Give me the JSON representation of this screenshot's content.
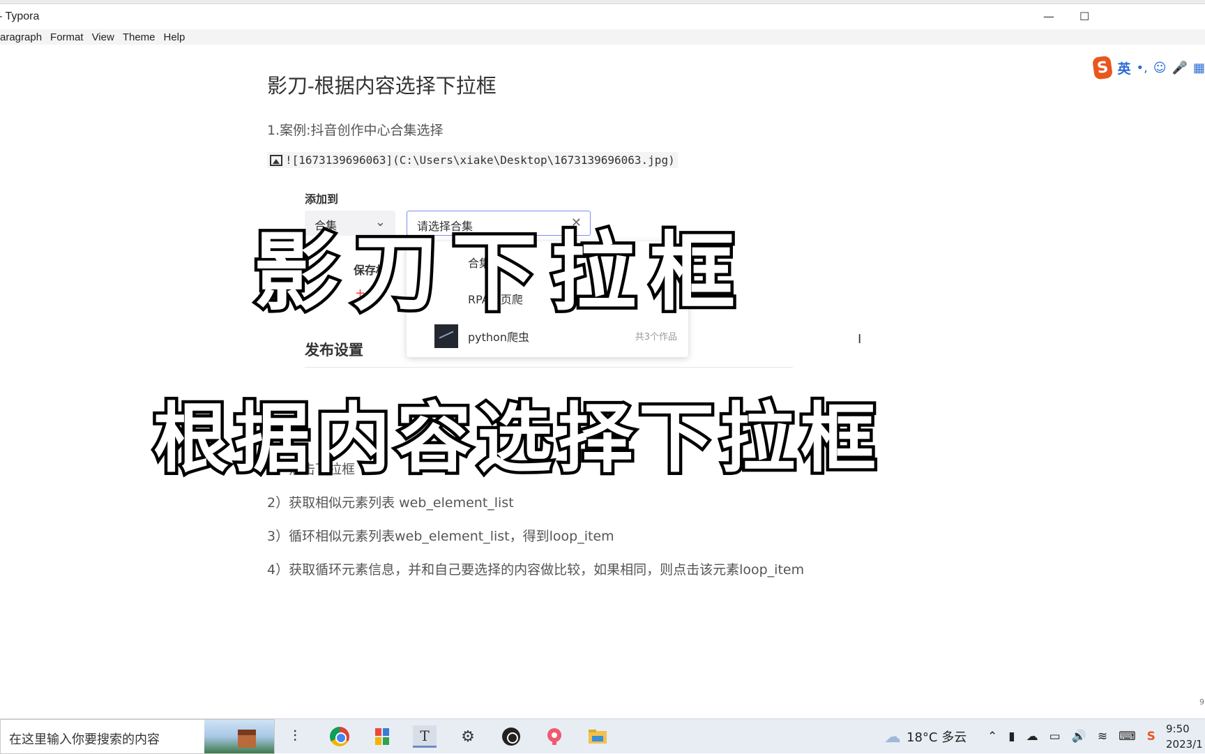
{
  "window": {
    "title": "- Typora",
    "minimize": "—",
    "maximize": "☐"
  },
  "menubar": {
    "items": [
      "aragraph",
      "Format",
      "View",
      "Theme",
      "Help"
    ]
  },
  "ime": {
    "logo": "S",
    "mode": "英",
    "punct": "•,",
    "emoji": "☺",
    "mic": "🎤",
    "grid": "▦"
  },
  "document": {
    "title": "影刀-根据内容选择下拉框",
    "case": "1.案例:抖音创作中心合集选择",
    "image_link": "![1673139696063](C:\\Users\\xiake\\Desktop\\1673139696063.jpg)",
    "steps": [
      "1）点击下拉框",
      "2）获取相似元素列表 web_element_list",
      "3）循环相似元素列表web_element_list，得到loop_item",
      "4）获取循环元素信息，并和自己要选择的内容做比较，如果相同，则点击该元素loop_item"
    ]
  },
  "embedded": {
    "add_to_label": "添加到",
    "left_select": "合集",
    "placeholder": "请选择合集",
    "dropdown_items": [
      {
        "name": "合集",
        "count": ""
      },
      {
        "name": "RPA网页爬",
        "count": ""
      },
      {
        "name": "python爬虫",
        "count": "共3个作品"
      }
    ],
    "save_label": "保存权",
    "plus": "+",
    "publish_settings": "发布设置"
  },
  "overlay": {
    "line1": "影刀下拉框",
    "line2": "根据内容选择下拉框"
  },
  "page_number": "9",
  "taskbar": {
    "search_placeholder": "在这里输入你要搜索的内容",
    "weather": "18°C 多云",
    "time": "9:50",
    "date": "2023/1"
  }
}
